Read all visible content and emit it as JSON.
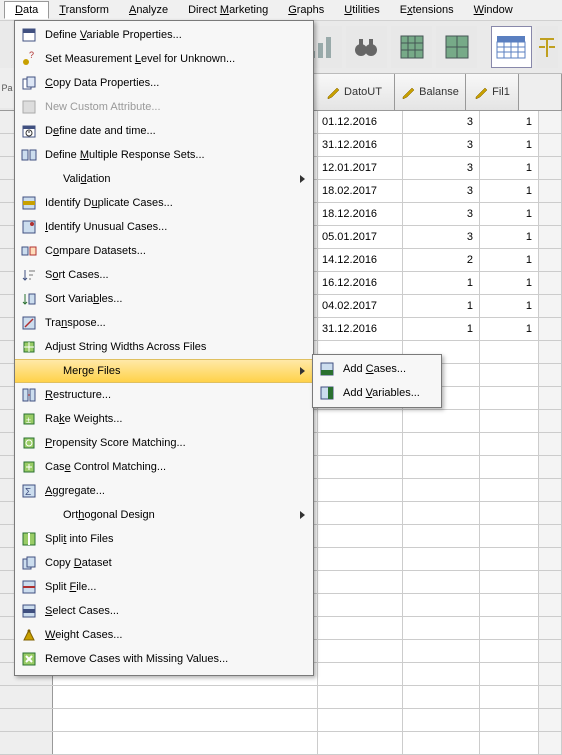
{
  "menubar": {
    "items": [
      {
        "pre": "",
        "u": "D",
        "post": "ata",
        "active": true
      },
      {
        "pre": "",
        "u": "T",
        "post": "ransform"
      },
      {
        "pre": "",
        "u": "A",
        "post": "nalyze"
      },
      {
        "pre": "Direct ",
        "u": "M",
        "post": "arketing"
      },
      {
        "pre": "",
        "u": "G",
        "post": "raphs"
      },
      {
        "pre": "",
        "u": "U",
        "post": "tilities"
      },
      {
        "pre": "E",
        "u": "x",
        "post": "tensions"
      },
      {
        "pre": "",
        "u": "W",
        "post": "indow"
      }
    ]
  },
  "left_strip": "Pa",
  "columns": {
    "dato": "DatoUT",
    "bal": "Balanse",
    "fil": "Fil1"
  },
  "rows": [
    {
      "dato": "01.12.2016",
      "bal": "3",
      "fil": "1"
    },
    {
      "dato": "31.12.2016",
      "bal": "3",
      "fil": "1"
    },
    {
      "dato": "12.01.2017",
      "bal": "3",
      "fil": "1"
    },
    {
      "dato": "18.02.2017",
      "bal": "3",
      "fil": "1"
    },
    {
      "dato": "18.12.2016",
      "bal": "3",
      "fil": "1"
    },
    {
      "dato": "05.01.2017",
      "bal": "3",
      "fil": "1"
    },
    {
      "dato": "14.12.2016",
      "bal": "2",
      "fil": "1"
    },
    {
      "dato": "16.12.2016",
      "bal": "1",
      "fil": "1"
    },
    {
      "dato": "04.02.2017",
      "bal": "1",
      "fil": "1"
    },
    {
      "dato": "31.12.2016",
      "bal": "1",
      "fil": "1"
    }
  ],
  "menu": {
    "items": [
      {
        "icon": "var-props",
        "pre": "Define ",
        "u": "V",
        "post": "ariable Properties..."
      },
      {
        "icon": "meas-level",
        "pre": "Set Measurement ",
        "u": "L",
        "post": "evel for Unknown..."
      },
      {
        "icon": "copy-data",
        "pre": "",
        "u": "C",
        "post": "opy Data Properties..."
      },
      {
        "icon": "new-attr",
        "pre": "",
        "u": "",
        "post": "New Custom Attribute...",
        "disabled": true
      },
      {
        "icon": "date",
        "pre": "D",
        "u": "e",
        "post": "fine date and time..."
      },
      {
        "icon": "multi-resp",
        "pre": "Define ",
        "u": "M",
        "post": "ultiple Response Sets..."
      },
      {
        "icon": "",
        "pre": "Vali",
        "u": "d",
        "post": "ation",
        "indent": true,
        "sub": true
      },
      {
        "icon": "dup",
        "pre": "Identify D",
        "u": "u",
        "post": "plicate Cases..."
      },
      {
        "icon": "unusual",
        "pre": "",
        "u": "I",
        "post": "dentify Unusual Cases..."
      },
      {
        "icon": "compare",
        "pre": "C",
        "u": "o",
        "post": "mpare Datasets..."
      },
      {
        "icon": "sort",
        "pre": "S",
        "u": "o",
        "post": "rt Cases..."
      },
      {
        "icon": "sort-var",
        "pre": "Sort Varia",
        "u": "b",
        "post": "les..."
      },
      {
        "icon": "transpose",
        "pre": "Tra",
        "u": "n",
        "post": "spose..."
      },
      {
        "icon": "adjust",
        "pre": "Ad",
        "u": "j",
        "post": "ust String Widths Across Files"
      },
      {
        "icon": "",
        "pre": "Mer",
        "u": "g",
        "post": "e Files",
        "indent": true,
        "sub": true,
        "selected": true
      },
      {
        "icon": "restructure",
        "pre": "",
        "u": "R",
        "post": "estructure..."
      },
      {
        "icon": "rake",
        "pre": "Ra",
        "u": "k",
        "post": "e Weights..."
      },
      {
        "icon": "propensity",
        "pre": "",
        "u": "P",
        "post": "ropensity Score Matching..."
      },
      {
        "icon": "case-ctrl",
        "pre": "Cas",
        "u": "e",
        "post": " Control Matching..."
      },
      {
        "icon": "aggregate",
        "pre": "",
        "u": "A",
        "post": "ggregate..."
      },
      {
        "icon": "",
        "pre": "Ort",
        "u": "h",
        "post": "ogonal Design",
        "indent": true,
        "sub": true
      },
      {
        "icon": "split-files",
        "pre": "Spli",
        "u": "t",
        "post": " into Files"
      },
      {
        "icon": "copy-ds",
        "pre": "Copy ",
        "u": "D",
        "post": "ataset"
      },
      {
        "icon": "split-file",
        "pre": "Split ",
        "u": "F",
        "post": "ile..."
      },
      {
        "icon": "select",
        "pre": "",
        "u": "S",
        "post": "elect Cases..."
      },
      {
        "icon": "weight",
        "pre": "",
        "u": "W",
        "post": "eight Cases..."
      },
      {
        "icon": "remove",
        "pre": "Remove Cases with Missing Values...",
        "u": "",
        "post": ""
      }
    ]
  },
  "submenu": {
    "items": [
      {
        "icon": "add-cases",
        "pre": "Add ",
        "u": "C",
        "post": "ases..."
      },
      {
        "icon": "add-vars",
        "pre": "Add ",
        "u": "V",
        "post": "ariables..."
      }
    ]
  }
}
